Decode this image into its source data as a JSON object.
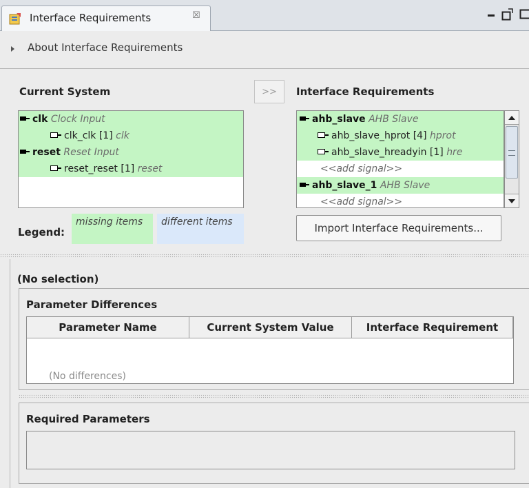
{
  "tab": {
    "title": "Interface Requirements",
    "close_glyph": "☒"
  },
  "window_controls": {
    "minimize": "minimize-icon",
    "maximize": "maximize-icon"
  },
  "about": {
    "label": "About Interface Requirements"
  },
  "current_system": {
    "title": "Current System",
    "items": [
      {
        "name": "clk",
        "type": "Clock Input",
        "kind": "interface",
        "status": "missing"
      },
      {
        "name": "clk_clk [1]",
        "role": "clk",
        "kind": "signal",
        "status": "missing"
      },
      {
        "name": "reset",
        "type": "Reset Input",
        "kind": "interface",
        "status": "missing"
      },
      {
        "name": "reset_reset [1]",
        "role": "reset",
        "kind": "signal",
        "status": "missing"
      }
    ]
  },
  "copy_button": {
    "label": ">>"
  },
  "interface_requirements": {
    "title": "Interface Requirements",
    "items": [
      {
        "name": "ahb_slave",
        "type": "AHB Slave",
        "kind": "interface",
        "status": "missing"
      },
      {
        "name": "ahb_slave_hprot [4]",
        "role": "hprot",
        "kind": "signal",
        "status": "missing"
      },
      {
        "name": "ahb_slave_hreadyin [1]",
        "role": "hre",
        "kind": "signal",
        "status": "missing"
      },
      {
        "name": "<<add signal>>",
        "kind": "placeholder",
        "status": "none"
      },
      {
        "name": "ahb_slave_1",
        "type": "AHB Slave",
        "kind": "interface",
        "status": "missing"
      },
      {
        "name": "<<add signal>>",
        "kind": "placeholder",
        "status": "none"
      }
    ]
  },
  "legend": {
    "label": "Legend:",
    "missing": "missing items",
    "different": "different items"
  },
  "colors": {
    "missing": "#c4f5c4",
    "different": "#dae8fa"
  },
  "import_button": {
    "label": "Import Interface Requirements..."
  },
  "selection": {
    "label": "(No selection)"
  },
  "parameter_differences": {
    "title": "Parameter Differences",
    "columns": [
      "Parameter Name",
      "Current System Value",
      "Interface Requirement"
    ],
    "empty_text": "(No differences)"
  },
  "required_parameters": {
    "title": "Required Parameters"
  }
}
